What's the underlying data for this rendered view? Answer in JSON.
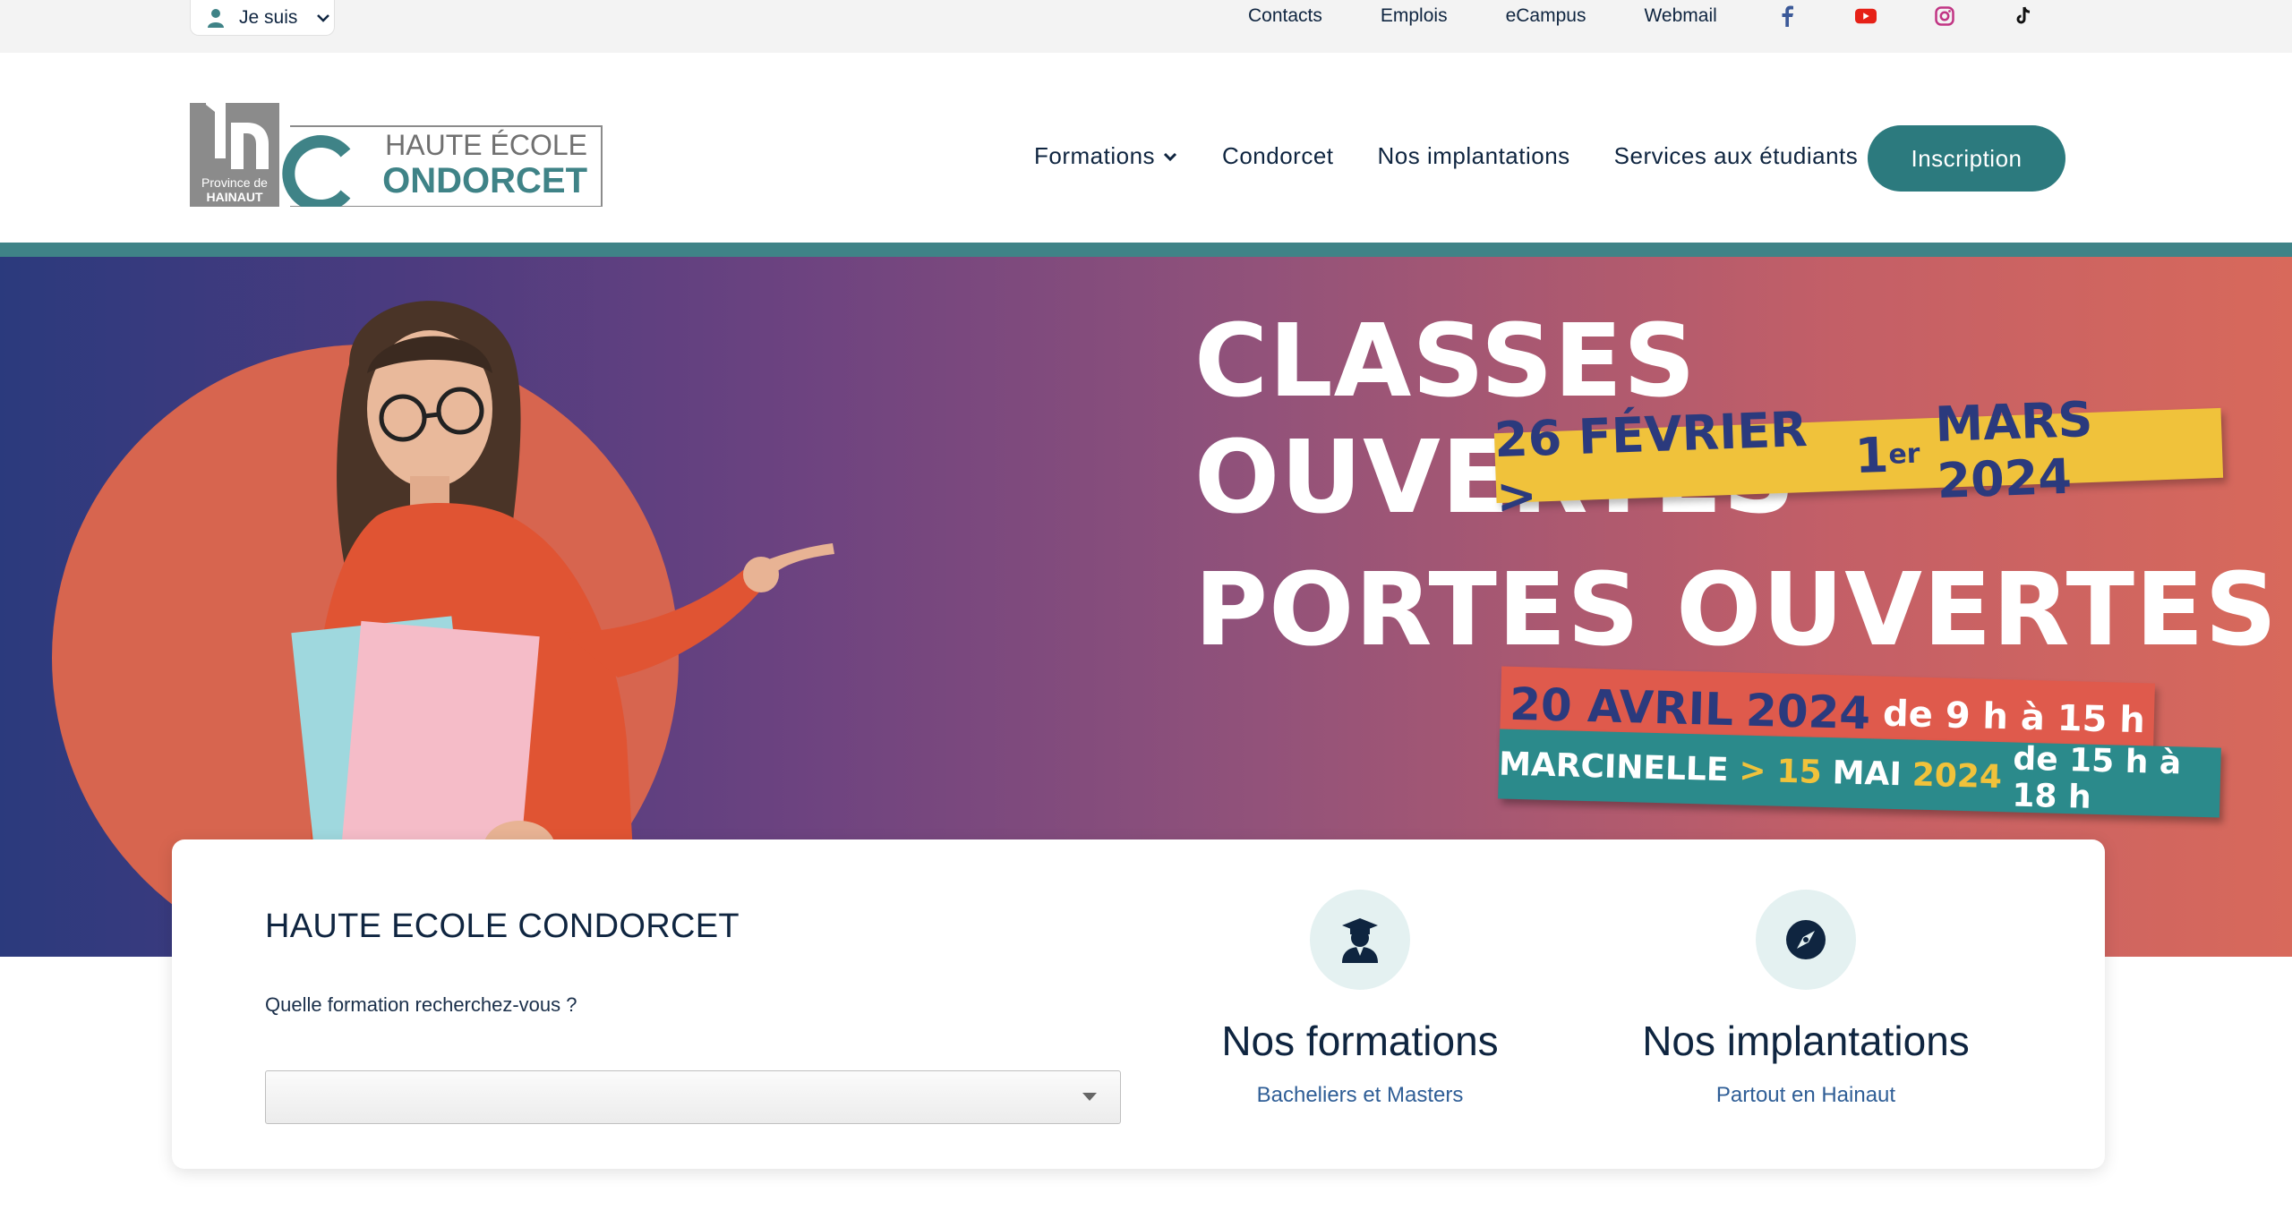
{
  "topbar": {
    "iam_label": "Je suis",
    "links": [
      "Contacts",
      "Emplois",
      "eCampus",
      "Webmail"
    ],
    "social": [
      "facebook-icon",
      "youtube-icon",
      "instagram-icon",
      "tiktok-icon"
    ]
  },
  "header": {
    "logo": {
      "province": "Province de",
      "province2": "HAINAUT",
      "line1": "HAUTE ÉCOLE",
      "line2": "ONDORCET"
    },
    "nav": [
      "Formations",
      "Condorcet",
      "Nos implantations",
      "Services aux étudiants"
    ],
    "cta": "Inscription"
  },
  "hero": {
    "headline1": "CLASSES OUVERTES",
    "dates1": {
      "start": "26 FÉVRIER >",
      "day": "1",
      "sup": "er",
      "end": "MARS 2024"
    },
    "headline2": "PORTES OUVERTES",
    "dates2": {
      "date": "20 AVRIL",
      "year": "2024",
      "hours": "de 9 h à 15 h"
    },
    "dates3": {
      "place": "MARCINELLE",
      "sep": ">",
      "date": "15",
      "month": "MAI",
      "year": "2024",
      "hours": "de 15 h à 18 h"
    }
  },
  "search": {
    "title": "HAUTE ECOLE CONDORCET",
    "question": "Quelle formation recherchez-vous ?",
    "select_value": ""
  },
  "features": [
    {
      "icon": "graduate-icon",
      "title": "Nos formations",
      "subtitle": "Bacheliers et Masters"
    },
    {
      "icon": "compass-icon",
      "title": "Nos implantations",
      "subtitle": "Partout en Hainaut"
    }
  ],
  "colors": {
    "brand_teal": "#2c7a7e",
    "navy": "#0f2540",
    "link_blue": "#2f5e96",
    "yellow": "#f0c23b",
    "coral": "#df5a4c"
  }
}
